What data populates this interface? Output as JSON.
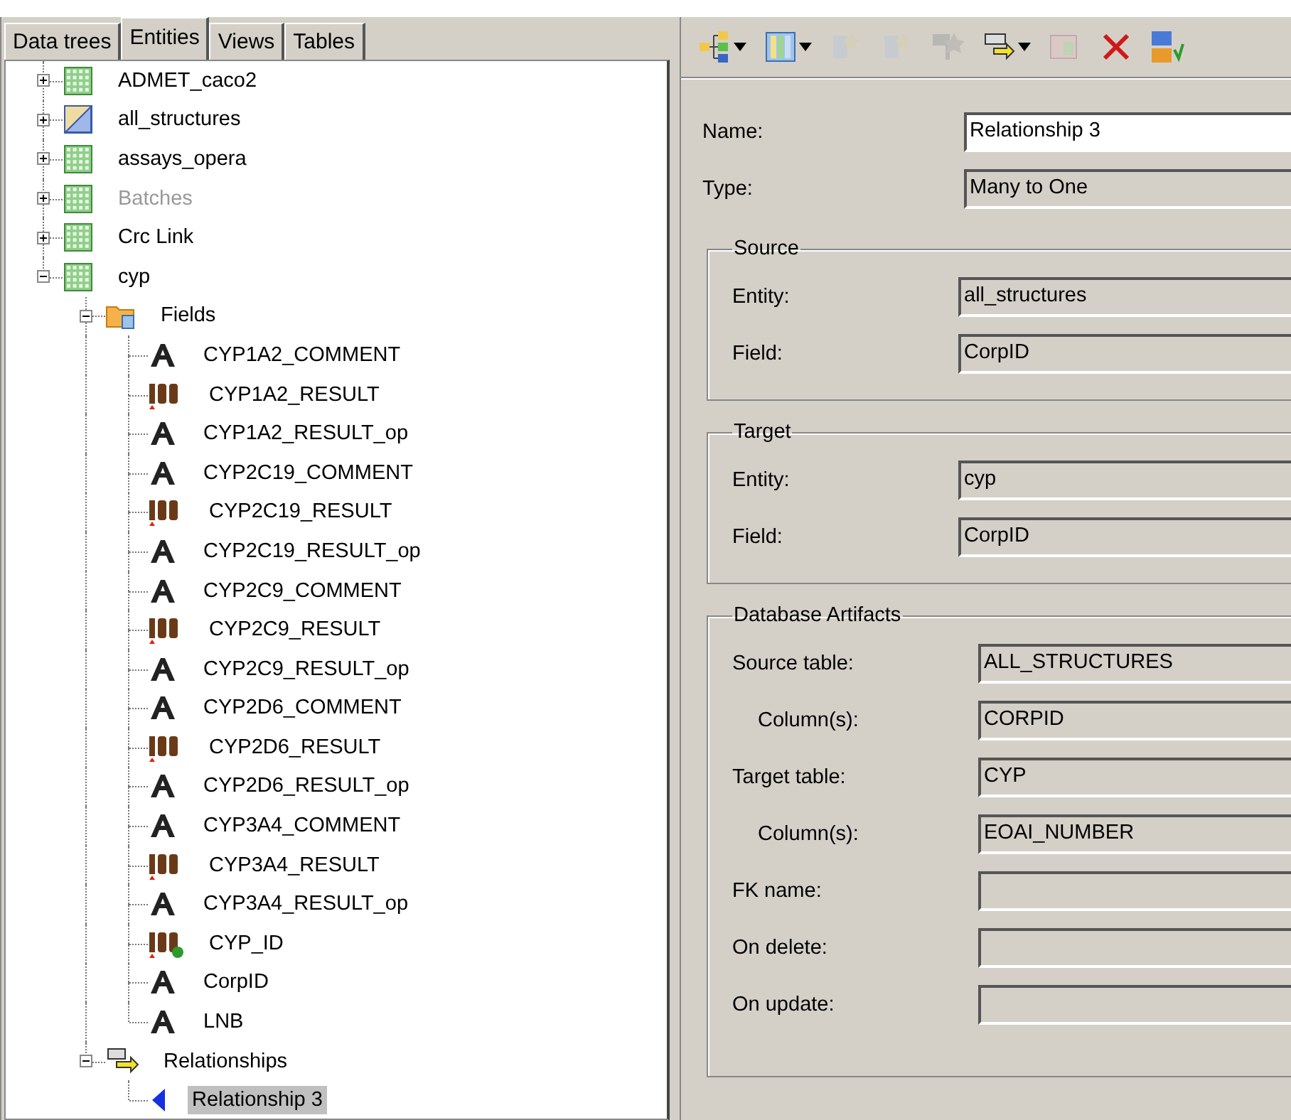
{
  "tabs": [
    {
      "label": "Data trees",
      "selected": false
    },
    {
      "label": "Entities",
      "selected": true
    },
    {
      "label": "Views",
      "selected": false
    },
    {
      "label": "Tables",
      "selected": false
    }
  ],
  "tree": [
    {
      "label": "ADMET_caco2",
      "kind": "table",
      "expanded": false,
      "disabled": false,
      "selected": false
    },
    {
      "label": "all_structures",
      "kind": "structure",
      "expanded": false,
      "disabled": false,
      "selected": false
    },
    {
      "label": "assays_opera",
      "kind": "table",
      "expanded": false,
      "disabled": false,
      "selected": false
    },
    {
      "label": "Batches",
      "kind": "table",
      "expanded": false,
      "disabled": true,
      "selected": false
    },
    {
      "label": "Crc Link",
      "kind": "table",
      "expanded": false,
      "disabled": false,
      "selected": false
    },
    {
      "label": "cyp",
      "kind": "table",
      "expanded": true,
      "disabled": false,
      "selected": false,
      "children": [
        {
          "label": "Fields",
          "kind": "folder",
          "expanded": true,
          "disabled": false,
          "selected": false,
          "children": [
            {
              "label": "CYP1A2_COMMENT",
              "kind": "text",
              "disabled": false,
              "selected": false
            },
            {
              "label": "CYP1A2_RESULT",
              "kind": "number",
              "disabled": false,
              "selected": false
            },
            {
              "label": "CYP1A2_RESULT_op",
              "kind": "text",
              "disabled": false,
              "selected": false
            },
            {
              "label": "CYP2C19_COMMENT",
              "kind": "text",
              "disabled": false,
              "selected": false
            },
            {
              "label": "CYP2C19_RESULT",
              "kind": "number",
              "disabled": false,
              "selected": false
            },
            {
              "label": "CYP2C19_RESULT_op",
              "kind": "text",
              "disabled": false,
              "selected": false
            },
            {
              "label": "CYP2C9_COMMENT",
              "kind": "text",
              "disabled": false,
              "selected": false
            },
            {
              "label": "CYP2C9_RESULT",
              "kind": "number",
              "disabled": false,
              "selected": false
            },
            {
              "label": "CYP2C9_RESULT_op",
              "kind": "text",
              "disabled": false,
              "selected": false
            },
            {
              "label": "CYP2D6_COMMENT",
              "kind": "text",
              "disabled": false,
              "selected": false
            },
            {
              "label": "CYP2D6_RESULT",
              "kind": "number",
              "disabled": false,
              "selected": false
            },
            {
              "label": "CYP2D6_RESULT_op",
              "kind": "text",
              "disabled": false,
              "selected": false
            },
            {
              "label": "CYP3A4_COMMENT",
              "kind": "text",
              "disabled": false,
              "selected": false
            },
            {
              "label": "CYP3A4_RESULT",
              "kind": "number",
              "disabled": false,
              "selected": false
            },
            {
              "label": "CYP3A4_RESULT_op",
              "kind": "text",
              "disabled": false,
              "selected": false
            },
            {
              "label": "CYP_ID",
              "kind": "key",
              "disabled": false,
              "selected": false
            },
            {
              "label": "CorpID",
              "kind": "text",
              "disabled": false,
              "selected": false
            },
            {
              "label": "LNB",
              "kind": "text",
              "disabled": false,
              "selected": false
            }
          ]
        },
        {
          "label": "Relationships",
          "kind": "relationships",
          "expanded": true,
          "disabled": false,
          "selected": false,
          "children": [
            {
              "label": "Relationship 3",
              "kind": "relationship",
              "disabled": false,
              "selected": true
            }
          ]
        }
      ]
    }
  ],
  "toolbar": [
    {
      "kind": "hierarchy",
      "dropdown": true,
      "disabled": false
    },
    {
      "kind": "columns",
      "dropdown": true,
      "disabled": false
    },
    {
      "kind": "star-field",
      "dropdown": false,
      "disabled": true
    },
    {
      "kind": "star-field",
      "dropdown": false,
      "disabled": true
    },
    {
      "kind": "flag-star",
      "dropdown": false,
      "disabled": true
    },
    {
      "kind": "relationship",
      "dropdown": true,
      "disabled": false
    },
    {
      "kind": "table-star",
      "dropdown": false,
      "disabled": true
    },
    {
      "kind": "delete",
      "dropdown": false,
      "disabled": false
    },
    {
      "kind": "sort",
      "dropdown": false,
      "disabled": false
    }
  ],
  "form": {
    "rows": [
      {
        "label": "Name:",
        "value": "Relationship 3",
        "editable": true
      },
      {
        "label": "Type:",
        "value": "Many to One",
        "editable": false
      }
    ],
    "groups": [
      {
        "title": "Source",
        "rows": [
          {
            "label": "Entity:",
            "value": "all_structures",
            "indented": false
          },
          {
            "label": "Field:",
            "value": "CorpID",
            "indented": false
          }
        ]
      },
      {
        "title": "Target",
        "rows": [
          {
            "label": "Entity:",
            "value": "cyp",
            "indented": false
          },
          {
            "label": "Field:",
            "value": "CorpID",
            "indented": false
          }
        ]
      },
      {
        "title": "Database Artifacts",
        "rows": [
          {
            "label": "Source table:",
            "value": "ALL_STRUCTURES",
            "indented": false
          },
          {
            "label": "Column(s):",
            "value": "CORPID",
            "indented": true
          },
          {
            "label": "Target table:",
            "value": "CYP",
            "indented": false
          },
          {
            "label": "Column(s):",
            "value": "EOAI_NUMBER",
            "indented": true
          },
          {
            "label": "FK name:",
            "value": "",
            "indented": false
          },
          {
            "label": "On delete:",
            "value": "",
            "indented": false
          },
          {
            "label": "On update:",
            "value": "",
            "indented": false
          }
        ]
      }
    ]
  }
}
